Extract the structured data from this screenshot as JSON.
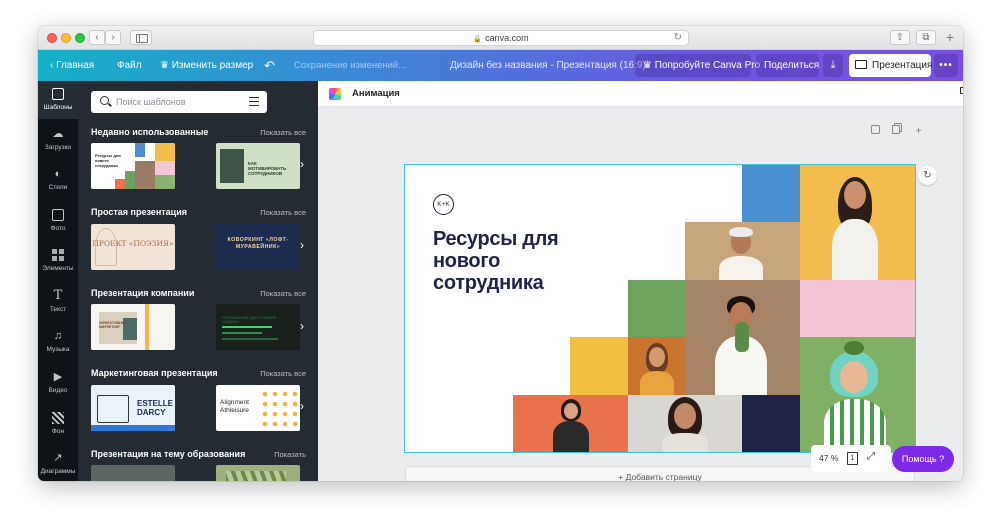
{
  "browser": {
    "url": "canva.com",
    "icons": [
      "back-icon",
      "forward-icon",
      "sidebar-icon",
      "lock-icon",
      "reload-icon",
      "share-icon",
      "tabs-icon",
      "new-tab-icon"
    ]
  },
  "toolbar": {
    "home_label": "Главная",
    "file_label": "Файл",
    "resize_label": "Изменить размер",
    "saving_status": "Сохранение изменений...",
    "design_title": "Дизайн без названия - Презентация (16:9)",
    "try_pro_label": "Попробуйте Canva Pro",
    "share_label": "Поделиться",
    "present_label": "Презентация",
    "more_label": "•••"
  },
  "rail": {
    "items": [
      {
        "label": "Шаблоны",
        "icon": "templates-icon",
        "active": true
      },
      {
        "label": "Загрузки",
        "icon": "uploads-icon"
      },
      {
        "label": "Стили",
        "icon": "styles-icon"
      },
      {
        "label": "Фото",
        "icon": "photos-icon"
      },
      {
        "label": "Элементы",
        "icon": "elements-icon"
      },
      {
        "label": "Текст",
        "icon": "text-icon"
      },
      {
        "label": "Музыка",
        "icon": "music-icon"
      },
      {
        "label": "Видео",
        "icon": "video-icon"
      },
      {
        "label": "Фон",
        "icon": "background-icon"
      },
      {
        "label": "Диаграммы",
        "icon": "charts-icon"
      }
    ]
  },
  "panel": {
    "search_placeholder": "Поиск шаблонов",
    "sections": [
      {
        "title": "Недавно использованные",
        "more": "Показать все",
        "thumbs": [
          {
            "text": "Ресурсы для нового сотрудника"
          },
          {
            "text": "КАК МОТИВИРОВАТЬ СОТРУДНИКОВ"
          }
        ]
      },
      {
        "title": "Простая презентация",
        "more": "Показать все",
        "thumbs": [
          {
            "text": "ПРОЕКТ «ПОЭЗИЯ»"
          },
          {
            "text": "КОВОРКИНГ «ЛОФТ-МУРАВЕЙНИК»"
          }
        ]
      },
      {
        "title": "Презентация компании",
        "more": "Показать все",
        "thumbs": [
          {
            "text": "ЭФФЕКТИВНЫЙ МАРКЕТИНГ"
          },
          {
            "text": "ПРИГЛАШЕНИЕ ДЛЯ СТАЖЁРА «КОДИНГ»"
          }
        ]
      },
      {
        "title": "Маркетинговая презентация",
        "more": "Показать все",
        "thumbs": [
          {
            "text": "ESTELLE DARCY"
          },
          {
            "text": "Alignment Athleisure"
          }
        ]
      },
      {
        "title": "Презентация на тему образования",
        "more": "Показать",
        "thumbs": []
      }
    ]
  },
  "editor": {
    "animation_label": "Анимация",
    "slide": {
      "logo_text": "K+K",
      "headline": "Ресурсы для нового сотрудника",
      "colors": {
        "navy": "#1e2347",
        "blue": "#4a90d0",
        "yellow": "#f3bd4e",
        "pink": "#f4c6d6",
        "green": "#6aa35c",
        "orange": "#e9714c",
        "mustard": "#f2c040",
        "tan": "#c8a47d"
      }
    },
    "add_page_label": "+ Добавить страницу",
    "zoom_label": "47 %",
    "page_count": "1",
    "help_label": "Помощь ?"
  },
  "colors": {
    "accent": "#7d2ae8",
    "header_start": "#14b1c6",
    "header_end": "#7a4fe2",
    "panel_bg": "#252b33",
    "rail_bg": "#0e1318",
    "slide_outline": "#3fc6d8"
  }
}
